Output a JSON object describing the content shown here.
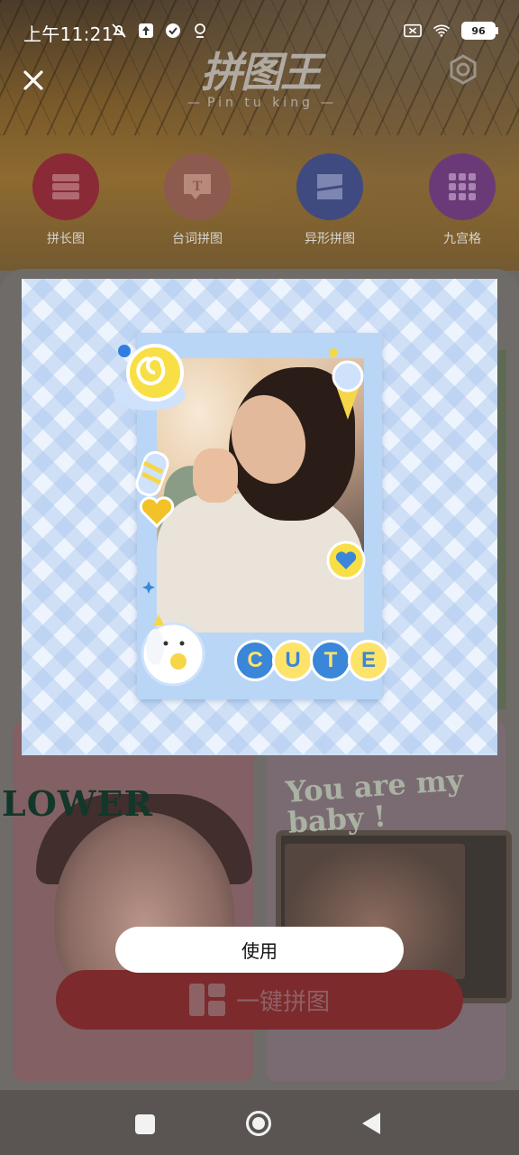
{
  "status_bar": {
    "time": "上午11:21",
    "battery": "96"
  },
  "header": {
    "logo_title": "拼图王",
    "logo_subtitle": "Pin tu king"
  },
  "categories": [
    {
      "label": "拼长图",
      "color": "#8a2a36"
    },
    {
      "label": "台词拼图",
      "color": "#8c5a4f"
    },
    {
      "label": "异形拼图",
      "color": "#3e4a80"
    },
    {
      "label": "九宫格",
      "color": "#6a3a78"
    }
  ],
  "templates": {
    "left_text": "LOWER",
    "right_text": "You are my baby !"
  },
  "preview": {
    "sticker_text": [
      "C",
      "U",
      "T",
      "E"
    ]
  },
  "actions": {
    "use_label": "使用",
    "one_click_label": "一键拼图"
  }
}
